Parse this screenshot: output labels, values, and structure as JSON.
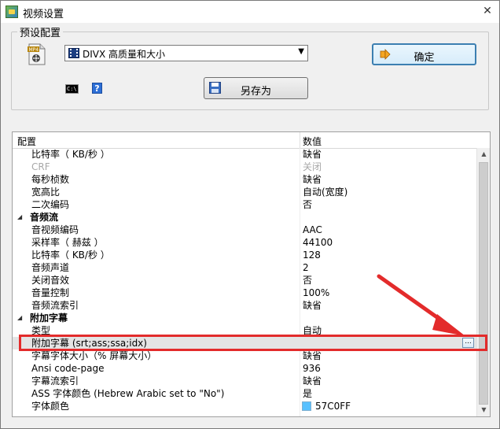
{
  "window": {
    "title": "视频设置",
    "close_glyph": "✕"
  },
  "preset": {
    "legend": "预设配置",
    "selected_value": "DIVX 高质量和大小",
    "ok_label": "确定",
    "save_as_label": "另存为",
    "cmd_icon_text": "C:\\"
  },
  "grid": {
    "col_name": "配置",
    "col_value": "数值",
    "rows": [
      {
        "name": "比特率（ KB/秒 ）",
        "value": "缺省"
      },
      {
        "name": "CRF",
        "value": "关闭"
      },
      {
        "name": "每秒桢数",
        "value": "缺省"
      },
      {
        "name": "宽高比",
        "value": "自动(宽度)"
      },
      {
        "name": "二次编码",
        "value": "否"
      },
      {
        "name": "音频流",
        "value": ""
      },
      {
        "name": "音视频编码",
        "value": "AAC"
      },
      {
        "name": "采样率（ 赫兹 ）",
        "value": "44100"
      },
      {
        "name": "比特率（ KB/秒 ）",
        "value": "128"
      },
      {
        "name": "音频声道",
        "value": "2"
      },
      {
        "name": "关闭音效",
        "value": "否"
      },
      {
        "name": "音量控制",
        "value": "100%"
      },
      {
        "name": "音频流索引",
        "value": "缺省"
      },
      {
        "name": "附加字幕",
        "value": ""
      },
      {
        "name": "类型",
        "value": "自动"
      },
      {
        "name": "附加字幕 (srt;ass;ssa;idx)",
        "value": ""
      },
      {
        "name": "字幕字体大小（% 屏幕大小）",
        "value": "缺省"
      },
      {
        "name": "Ansi code-page",
        "value": "936"
      },
      {
        "name": "字幕流索引",
        "value": "缺省"
      },
      {
        "name": "ASS 字体颜色 (Hebrew Arabic set to \"No\")",
        "value": "是"
      },
      {
        "name": "字体颜色",
        "value": "57C0FF"
      }
    ],
    "ellipsis_label": "..."
  },
  "colors": {
    "highlight": "#e32b2b",
    "font_color_swatch": "#57c0ff"
  }
}
